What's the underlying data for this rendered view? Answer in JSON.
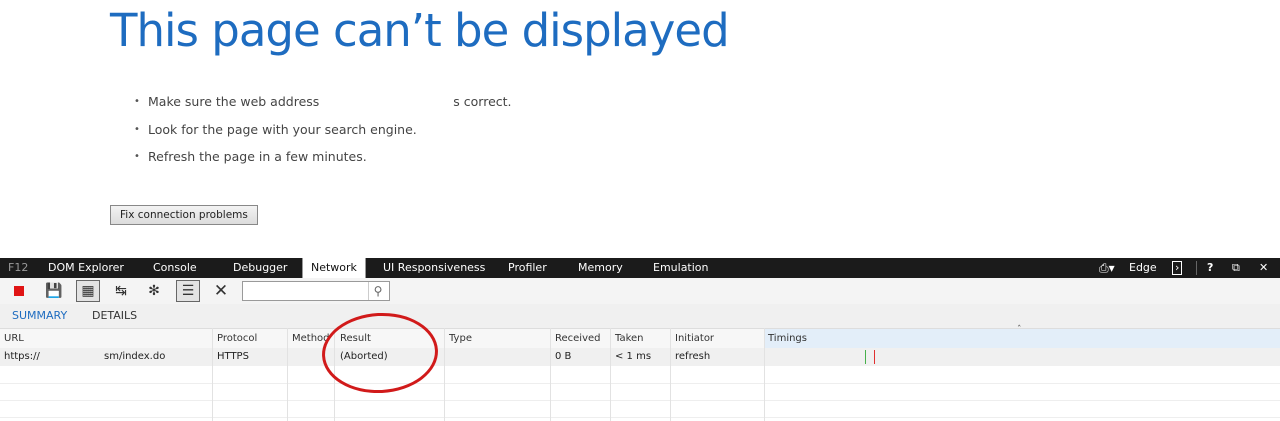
{
  "error_page": {
    "title": "This page can’t be displayed",
    "tips": [
      {
        "text": "Make sure the web address",
        "tail": "s correct."
      },
      {
        "text": "Look for the page with your search engine.",
        "tail": ""
      },
      {
        "text": "Refresh the page in a few minutes.",
        "tail": ""
      }
    ],
    "fix_button": "Fix connection problems"
  },
  "devtools": {
    "tabs": [
      {
        "label": "F12"
      },
      {
        "label": "DOM Explorer"
      },
      {
        "label": "Console"
      },
      {
        "label": "Debugger"
      },
      {
        "label": "Network",
        "active": true
      },
      {
        "label": "UI Responsiveness"
      },
      {
        "label": "Profiler"
      },
      {
        "label": "Memory"
      },
      {
        "label": "Emulation"
      }
    ],
    "document_mode": "Edge",
    "toolbar_icons": [
      "stop-recording-icon",
      "save-icon",
      "always-refresh-icon",
      "clear-on-navigate-icon",
      "clear-cache-icon",
      "details-view-icon",
      "clear-session-icon",
      "search-icon"
    ],
    "subtabs": {
      "summary": "SUMMARY",
      "details": "DETAILS"
    },
    "columns": [
      "URL",
      "Protocol",
      "Method",
      "Result",
      "Type",
      "Received",
      "Taken",
      "Initiator",
      "Timings"
    ],
    "rows": [
      {
        "url_start": "https://",
        "url_end": "sm/index.do",
        "protocol": "HTTPS",
        "method": "",
        "result": "(Aborted)",
        "type": "",
        "received": "0 B",
        "taken": "< 1 ms",
        "initiator": "refresh"
      }
    ],
    "colors": {
      "accent": "#1e6cc0",
      "tabbar": "#1b1b1b",
      "annotation": "#d11a1a",
      "timing_green": "#47b04b",
      "timing_red": "#e03030"
    }
  }
}
